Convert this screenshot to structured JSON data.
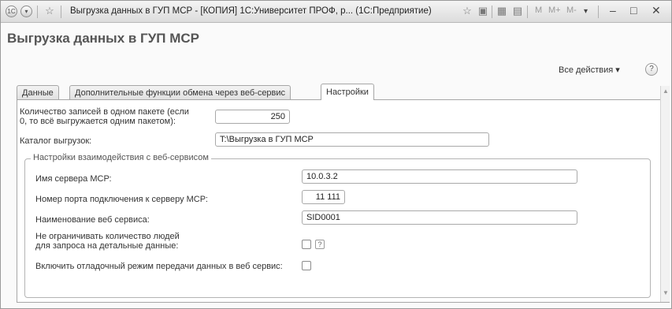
{
  "window": {
    "title": "Выгрузка данных в ГУП МСР - [КОПИЯ] 1С:Университет ПРОФ, р... (1С:Предприятие)",
    "buttons": {
      "m": "M",
      "mplus": "M+",
      "mminus": "M-"
    }
  },
  "form": {
    "title": "Выгрузка данных в ГУП МСР",
    "all_actions": "Все действия ▾",
    "help": "?"
  },
  "tabs": [
    {
      "label": "Данные"
    },
    {
      "label": "Дополнительные функции обмена через веб-сервис"
    },
    {
      "label": "Настройки"
    }
  ],
  "settings": {
    "packet_label_line1": "Количество записей в одном пакете (если",
    "packet_label_line2": "0, то всё выгружается одним пакетом):",
    "packet_value": "250",
    "dir_label": "Каталог выгрузок:",
    "dir_value": "T:\\Выгрузка в ГУП МСР",
    "group_title": "Настройки взаимодействия с веб-сервисом",
    "server_label": "Имя сервера МСР:",
    "server_value": "10.0.3.2",
    "port_label": "Номер порта подключения к серверу МСР:",
    "port_value": "11 111",
    "service_label": "Наименование веб сервиса:",
    "service_value": "SID0001",
    "nolimit_label_line1": "Не ограничивать количество людей",
    "nolimit_label_line2": "для запроса на детальные данные:",
    "nolimit_checked": false,
    "nolimit_help": "?",
    "debug_label": "Включить отладочный режим передачи данных в веб сервис:",
    "debug_checked": false
  }
}
